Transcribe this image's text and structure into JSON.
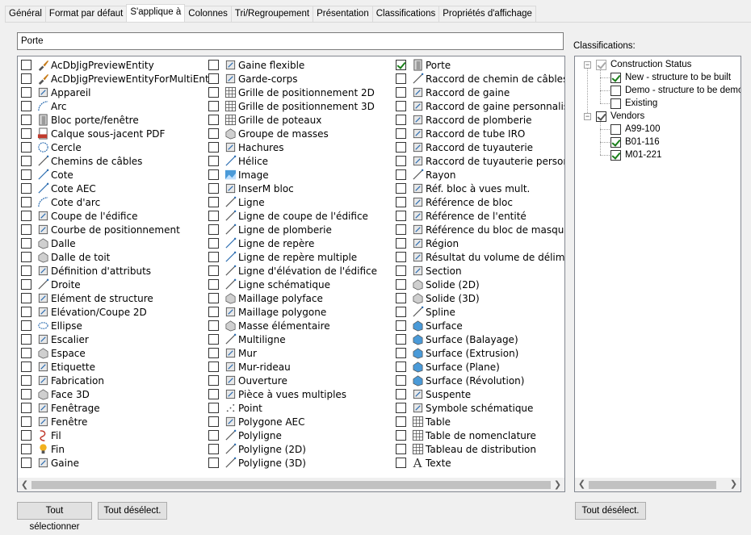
{
  "tabs": [
    "Général",
    "Format par défaut",
    "S'applique à",
    "Colonnes",
    "Tri/Regroupement",
    "Présentation",
    "Classifications",
    "Propriétés d'affichage"
  ],
  "active_tab": "S'applique à",
  "search": {
    "value": "Porte"
  },
  "object_list": {
    "columns": [
      [
        {
          "label": "AcDbJigPreviewEntity",
          "checked": false,
          "icon": "brush-icon"
        },
        {
          "label": "AcDbJigPreviewEntityForMultiEnts",
          "checked": false,
          "icon": "brush-icon"
        },
        {
          "label": "Appareil",
          "checked": false,
          "icon": "appliance-icon"
        },
        {
          "label": "Arc",
          "checked": false,
          "icon": "arc-icon"
        },
        {
          "label": "Bloc porte/fenêtre",
          "checked": false,
          "icon": "door-window-block-icon"
        },
        {
          "label": "Calque sous-jacent PDF",
          "checked": false,
          "icon": "pdf-icon"
        },
        {
          "label": "Cercle",
          "checked": false,
          "icon": "circle-icon"
        },
        {
          "label": "Chemins de câbles",
          "checked": false,
          "icon": "cable-tray-icon"
        },
        {
          "label": "Cote",
          "checked": false,
          "icon": "dimension-icon"
        },
        {
          "label": "Cote AEC",
          "checked": false,
          "icon": "aec-dimension-icon"
        },
        {
          "label": "Cote d'arc",
          "checked": false,
          "icon": "arc-dimension-icon"
        },
        {
          "label": "Coupe de l'édifice",
          "checked": false,
          "icon": "building-section-icon"
        },
        {
          "label": "Courbe de positionnement",
          "checked": false,
          "icon": "layout-curve-icon"
        },
        {
          "label": "Dalle",
          "checked": false,
          "icon": "slab-icon"
        },
        {
          "label": "Dalle de toit",
          "checked": false,
          "icon": "roof-slab-icon"
        },
        {
          "label": "Définition d'attributs",
          "checked": false,
          "icon": "attribute-icon"
        },
        {
          "label": "Droite",
          "checked": false,
          "icon": "xline-icon"
        },
        {
          "label": "Elément de structure",
          "checked": false,
          "icon": "structural-member-icon"
        },
        {
          "label": "Elévation/Coupe 2D",
          "checked": false,
          "icon": "elevation-icon"
        },
        {
          "label": "Ellipse",
          "checked": false,
          "icon": "ellipse-icon"
        },
        {
          "label": "Escalier",
          "checked": false,
          "icon": "stair-icon"
        },
        {
          "label": "Espace",
          "checked": false,
          "icon": "space-icon"
        },
        {
          "label": "Etiquette",
          "checked": false,
          "icon": "tag-icon"
        },
        {
          "label": "Fabrication",
          "checked": false,
          "icon": "fabrication-icon"
        },
        {
          "label": "Face 3D",
          "checked": false,
          "icon": "face-3d-icon"
        },
        {
          "label": "Fenêtrage",
          "checked": false,
          "icon": "curtain-window-icon"
        },
        {
          "label": "Fenêtre",
          "checked": false,
          "icon": "window-icon"
        },
        {
          "label": "Fil",
          "checked": false,
          "icon": "wire-icon"
        },
        {
          "label": "Fin",
          "checked": false,
          "icon": "bulb-icon"
        },
        {
          "label": "Gaine",
          "checked": false,
          "icon": "duct-icon"
        }
      ],
      [
        {
          "label": "Gaine flexible",
          "checked": false,
          "icon": "flex-duct-icon"
        },
        {
          "label": "Garde-corps",
          "checked": false,
          "icon": "railing-icon"
        },
        {
          "label": "Grille de positionnement 2D",
          "checked": false,
          "icon": "grid-2d-icon"
        },
        {
          "label": "Grille de positionnement 3D",
          "checked": false,
          "icon": "grid-3d-icon"
        },
        {
          "label": "Grille de poteaux",
          "checked": false,
          "icon": "column-grid-icon"
        },
        {
          "label": "Groupe de masses",
          "checked": false,
          "icon": "mass-group-icon"
        },
        {
          "label": "Hachures",
          "checked": false,
          "icon": "hatch-icon"
        },
        {
          "label": "Hélice",
          "checked": false,
          "icon": "helix-icon"
        },
        {
          "label": "Image",
          "checked": false,
          "icon": "image-icon"
        },
        {
          "label": "InserM bloc",
          "checked": false,
          "icon": "minsert-icon"
        },
        {
          "label": "Ligne",
          "checked": false,
          "icon": "line-icon"
        },
        {
          "label": "Ligne de coupe de l'édifice",
          "checked": false,
          "icon": "section-line-icon"
        },
        {
          "label": "Ligne de plomberie",
          "checked": false,
          "icon": "plumbing-line-icon"
        },
        {
          "label": "Ligne de repère",
          "checked": false,
          "icon": "leader-icon"
        },
        {
          "label": "Ligne de repère multiple",
          "checked": false,
          "icon": "multileader-icon"
        },
        {
          "label": "Ligne d'élévation de l'édifice",
          "checked": false,
          "icon": "elevation-line-icon"
        },
        {
          "label": "Ligne schématique",
          "checked": false,
          "icon": "schematic-line-icon"
        },
        {
          "label": "Maillage polyface",
          "checked": false,
          "icon": "polyface-mesh-icon"
        },
        {
          "label": "Maillage polygone",
          "checked": false,
          "icon": "polygon-mesh-icon"
        },
        {
          "label": "Masse élémentaire",
          "checked": false,
          "icon": "mass-element-icon"
        },
        {
          "label": "Multiligne",
          "checked": false,
          "icon": "mline-icon"
        },
        {
          "label": "Mur",
          "checked": false,
          "icon": "wall-icon"
        },
        {
          "label": "Mur-rideau",
          "checked": false,
          "icon": "curtain-wall-icon"
        },
        {
          "label": "Ouverture",
          "checked": false,
          "icon": "opening-icon"
        },
        {
          "label": "Pièce à vues multiples",
          "checked": false,
          "icon": "multi-view-part-icon"
        },
        {
          "label": "Point",
          "checked": false,
          "icon": "point-icon"
        },
        {
          "label": "Polygone AEC",
          "checked": false,
          "icon": "aec-polygon-icon"
        },
        {
          "label": "Polyligne",
          "checked": false,
          "icon": "polyline-icon"
        },
        {
          "label": "Polyligne (2D)",
          "checked": false,
          "icon": "polyline-2d-icon"
        },
        {
          "label": "Polyligne (3D)",
          "checked": false,
          "icon": "polyline-3d-icon"
        }
      ],
      [
        {
          "label": "Porte",
          "checked": true,
          "icon": "door-icon"
        },
        {
          "label": "Raccord de chemin de câbles",
          "checked": false,
          "icon": "cable-tray-fitting-icon"
        },
        {
          "label": "Raccord de gaine",
          "checked": false,
          "icon": "duct-fitting-icon"
        },
        {
          "label": "Raccord de gaine personnalisé",
          "checked": false,
          "icon": "custom-duct-fitting-icon"
        },
        {
          "label": "Raccord de plomberie",
          "checked": false,
          "icon": "plumbing-fitting-icon"
        },
        {
          "label": "Raccord de tube IRO",
          "checked": false,
          "icon": "conduit-fitting-icon"
        },
        {
          "label": "Raccord de tuyauterie",
          "checked": false,
          "icon": "pipe-fitting-icon"
        },
        {
          "label": "Raccord de tuyauterie personnalisé",
          "checked": false,
          "icon": "custom-pipe-fitting-icon"
        },
        {
          "label": "Rayon",
          "checked": false,
          "icon": "ray-icon"
        },
        {
          "label": "Réf. bloc à vues mult.",
          "checked": false,
          "icon": "mvblock-ref-icon"
        },
        {
          "label": "Référence de bloc",
          "checked": false,
          "icon": "block-ref-icon"
        },
        {
          "label": "Référence de l'entité",
          "checked": false,
          "icon": "entity-ref-icon"
        },
        {
          "label": "Référence du bloc de masquage",
          "checked": false,
          "icon": "masking-block-icon"
        },
        {
          "label": "Région",
          "checked": false,
          "icon": "region-icon"
        },
        {
          "label": "Résultat du volume de délimitation",
          "checked": false,
          "icon": "volume-result-icon"
        },
        {
          "label": "Section",
          "checked": false,
          "icon": "section-icon"
        },
        {
          "label": "Solide (2D)",
          "checked": false,
          "icon": "solid-2d-icon"
        },
        {
          "label": "Solide (3D)",
          "checked": false,
          "icon": "solid-3d-icon"
        },
        {
          "label": "Spline",
          "checked": false,
          "icon": "spline-icon"
        },
        {
          "label": "Surface",
          "checked": false,
          "icon": "surface-icon"
        },
        {
          "label": "Surface (Balayage)",
          "checked": false,
          "icon": "sweep-surface-icon"
        },
        {
          "label": "Surface (Extrusion)",
          "checked": false,
          "icon": "extrude-surface-icon"
        },
        {
          "label": "Surface (Plane)",
          "checked": false,
          "icon": "plane-surface-icon"
        },
        {
          "label": "Surface (Révolution)",
          "checked": false,
          "icon": "revolve-surface-icon"
        },
        {
          "label": "Suspente",
          "checked": false,
          "icon": "hanger-icon"
        },
        {
          "label": "Symbole schématique",
          "checked": false,
          "icon": "schematic-symbol-icon"
        },
        {
          "label": "Table",
          "checked": false,
          "icon": "table-icon"
        },
        {
          "label": "Table de nomenclature",
          "checked": false,
          "icon": "schedule-table-icon"
        },
        {
          "label": "Tableau de distribution",
          "checked": false,
          "icon": "panelboard-icon"
        },
        {
          "label": "Texte",
          "checked": false,
          "icon": "text-icon"
        }
      ]
    ]
  },
  "classifications": {
    "label": "Classifications:",
    "groups": [
      {
        "name": "Construction Status",
        "checked": true,
        "items": [
          {
            "name": "New - structure to be built",
            "checked": true
          },
          {
            "name": "Demo - structure to be demolished",
            "checked": false
          },
          {
            "name": "Existing",
            "checked": false
          }
        ]
      },
      {
        "name": "Vendors",
        "checked": true,
        "items": [
          {
            "name": "A99-100",
            "checked": false
          },
          {
            "name": "B01-116",
            "checked": true
          },
          {
            "name": "M01-221",
            "checked": true
          }
        ]
      }
    ]
  },
  "buttons": {
    "select_all": "Tout sélectionner",
    "deselect_all": "Tout désélect.",
    "deselect_all_classifications": "Tout désélect."
  },
  "colors": {
    "check": "#1a7f1a",
    "icon_blue": "#2b6cb0",
    "icon_gray": "#555555"
  }
}
